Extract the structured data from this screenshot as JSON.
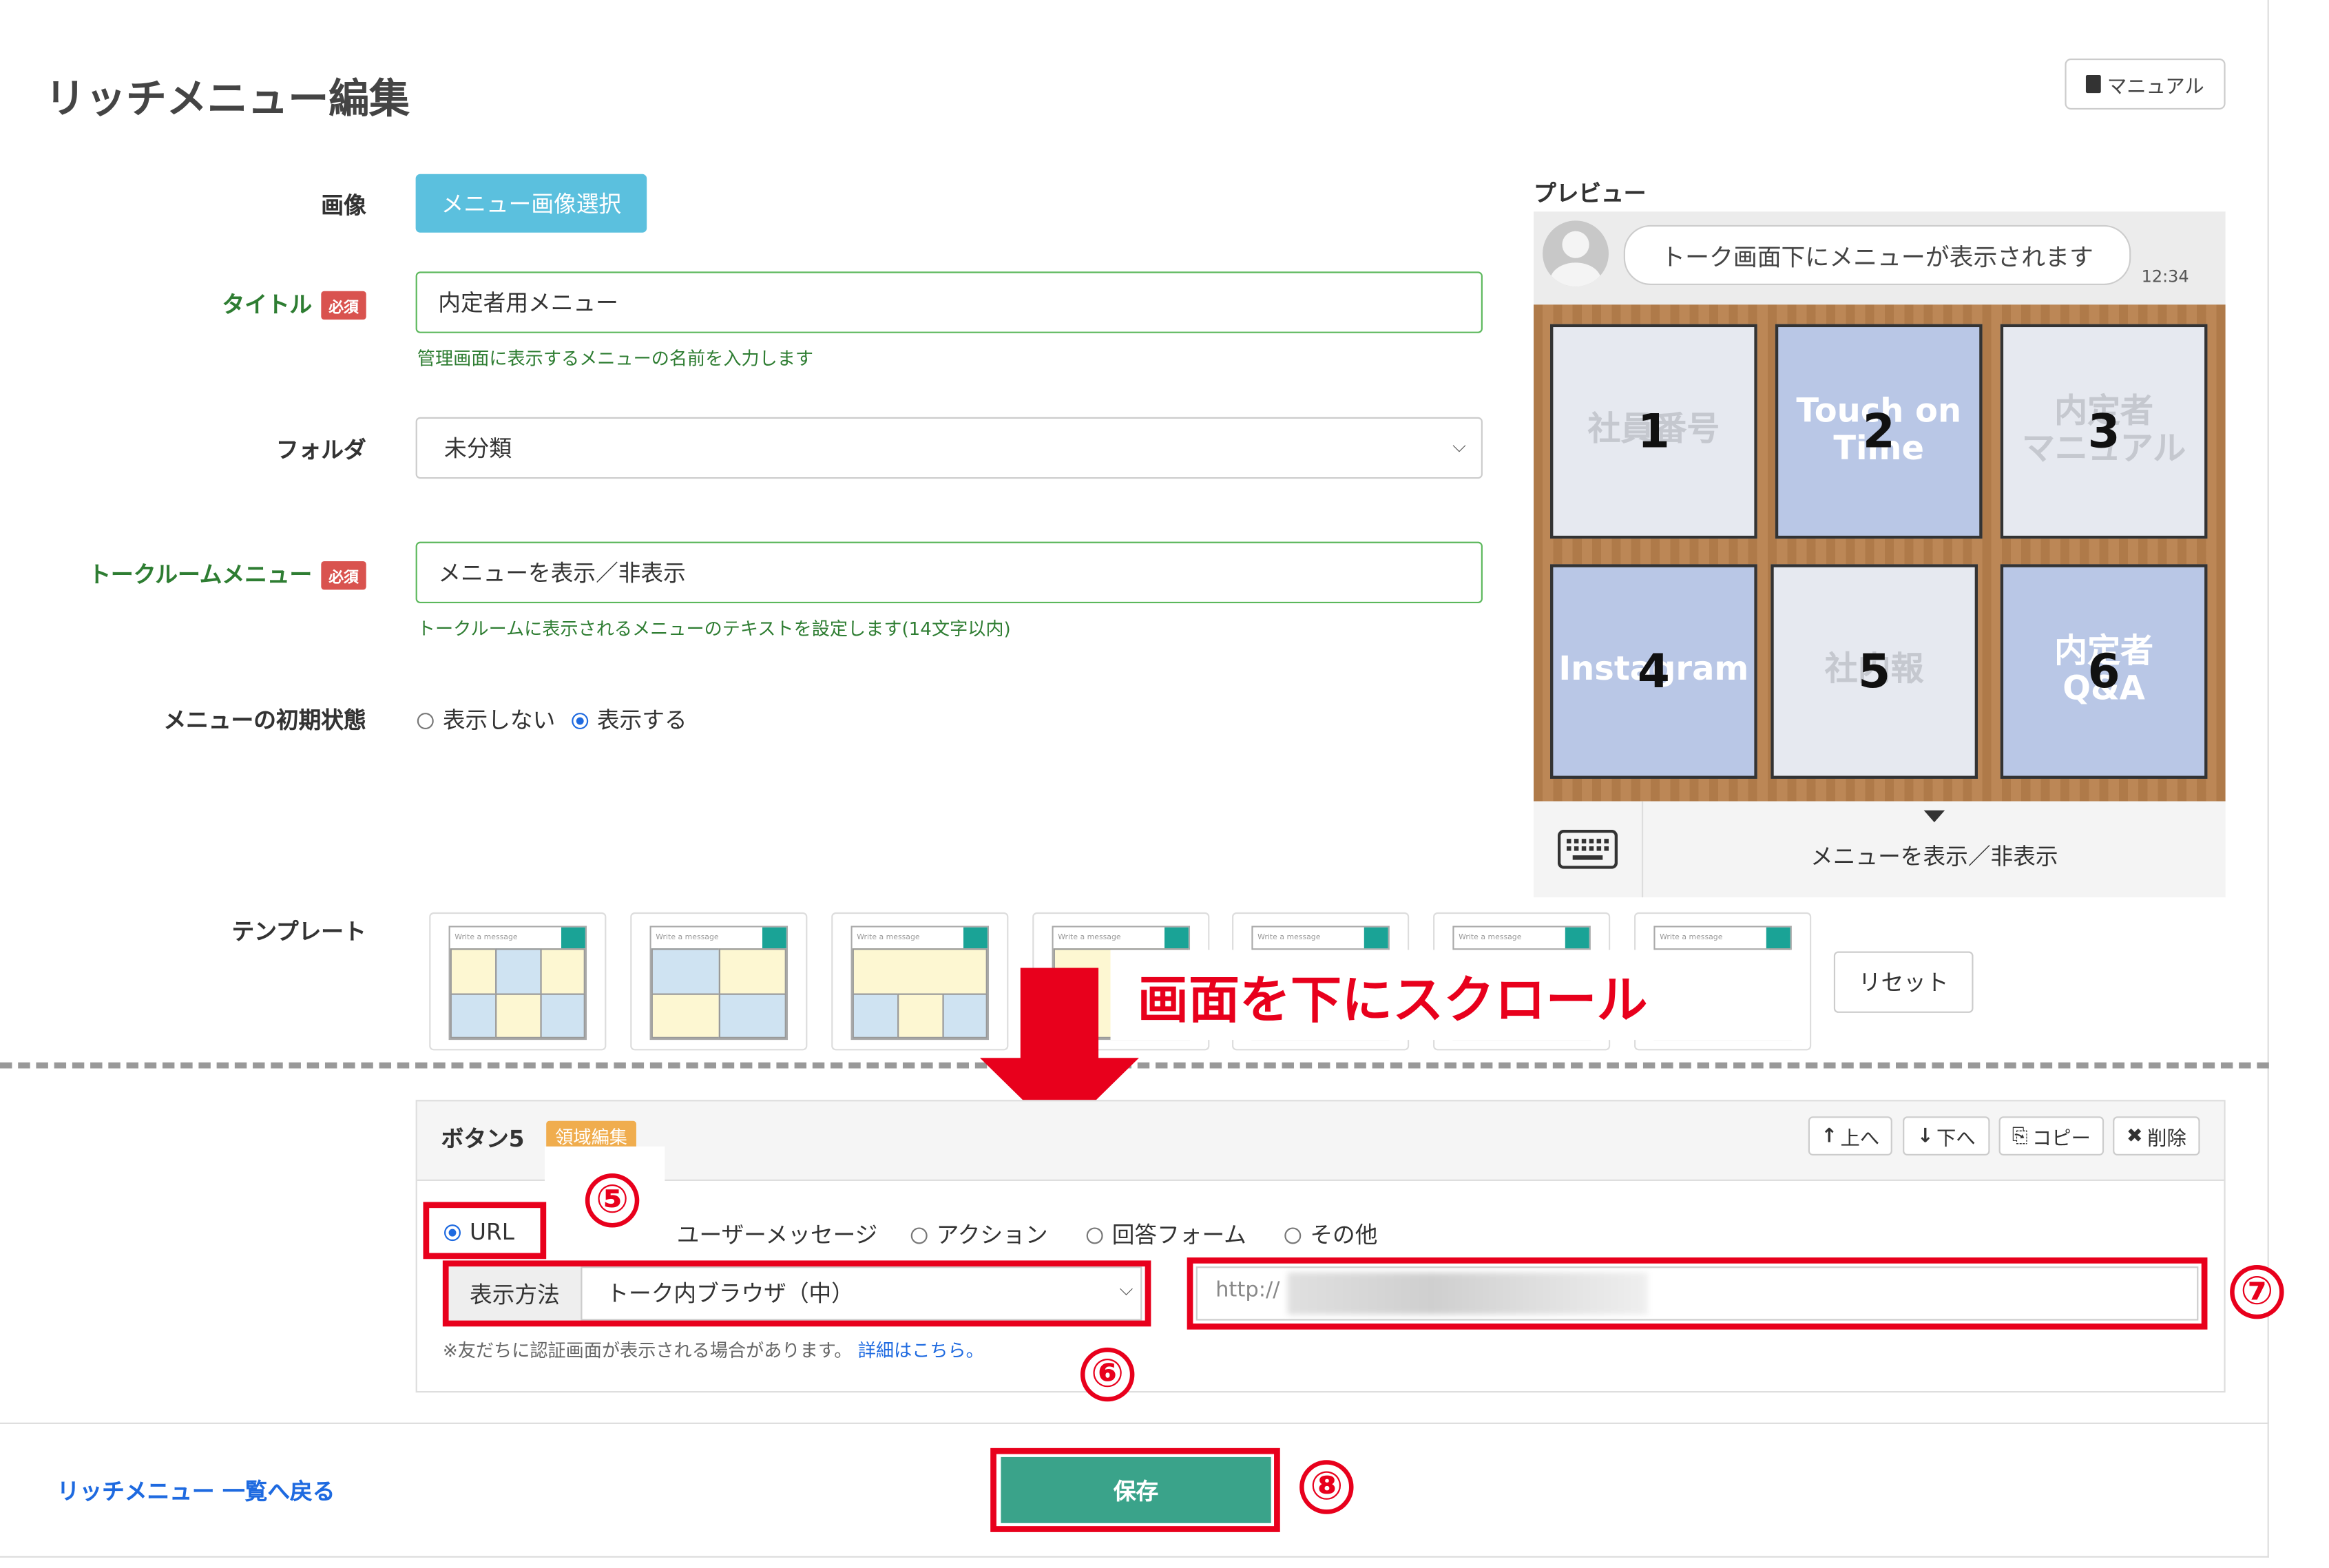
{
  "page": {
    "title": "リッチメニュー編集",
    "manual_label": "マニュアル"
  },
  "form": {
    "image_label": "画像",
    "image_button": "メニュー画像選択",
    "title_label": "タイトル",
    "required_badge": "必須",
    "title_value": "内定者用メニュー",
    "title_help": "管理画面に表示するメニューの名前を入力します",
    "folder_label": "フォルダ",
    "folder_value": "未分類",
    "talkroom_label": "トークルームメニュー",
    "talkroom_value": "メニューを表示／非表示",
    "talkroom_help": "トークルームに表示されるメニューのテキストを設定します(14文字以内)",
    "initial_label": "メニューの初期状態",
    "initial_options": [
      "表示しない",
      "表示する"
    ],
    "initial_selected": "表示する",
    "template_label": "テンプレート",
    "template_item_text": "Write a message",
    "reset_label": "リセット"
  },
  "preview": {
    "label": "プレビュー",
    "bubble_text": "トーク画面下にメニューが表示されます",
    "time": "12:34",
    "tiles": [
      {
        "num": "1",
        "bg": "社員番号",
        "style": "light"
      },
      {
        "num": "2",
        "bg": "Touch on Time",
        "style": "blue"
      },
      {
        "num": "3",
        "bg": "内定者\nマニュアル",
        "style": "light"
      },
      {
        "num": "4",
        "bg": "Instagram",
        "style": "blue"
      },
      {
        "num": "5",
        "bg": "社内報",
        "style": "light"
      },
      {
        "num": "6",
        "bg": "内定者\nQ&A",
        "style": "blue"
      }
    ],
    "footer_text": "メニューを表示／非表示"
  },
  "annotation": {
    "scroll_text": "画面を下にスクロール",
    "num5": "⑤",
    "num6": "⑥",
    "num7": "⑦",
    "num8": "⑧"
  },
  "button_panel": {
    "title": "ボタン5",
    "area_badge": "領域編集",
    "up": "上へ",
    "down": "下へ",
    "copy": "コピー",
    "delete": "削除",
    "action_types": [
      "URL",
      "ユーザーメッセージ",
      "アクション",
      "回答フォーム",
      "その他"
    ],
    "action_selected": "URL",
    "display_label": "表示方法",
    "display_value": "トーク内ブラウザ（中）",
    "url_value": "http://",
    "note_text": "※友だちに認証画面が表示される場合があります。",
    "note_link": "詳細はこちら。"
  },
  "footer": {
    "back_link": "リッチメニュー 一覧へ戻る",
    "save_label": "保存"
  },
  "colors": {
    "accent_red": "#e8001c",
    "save_green": "#3aa38a",
    "select_blue": "#5bc0de",
    "required_red": "#d9534f"
  }
}
